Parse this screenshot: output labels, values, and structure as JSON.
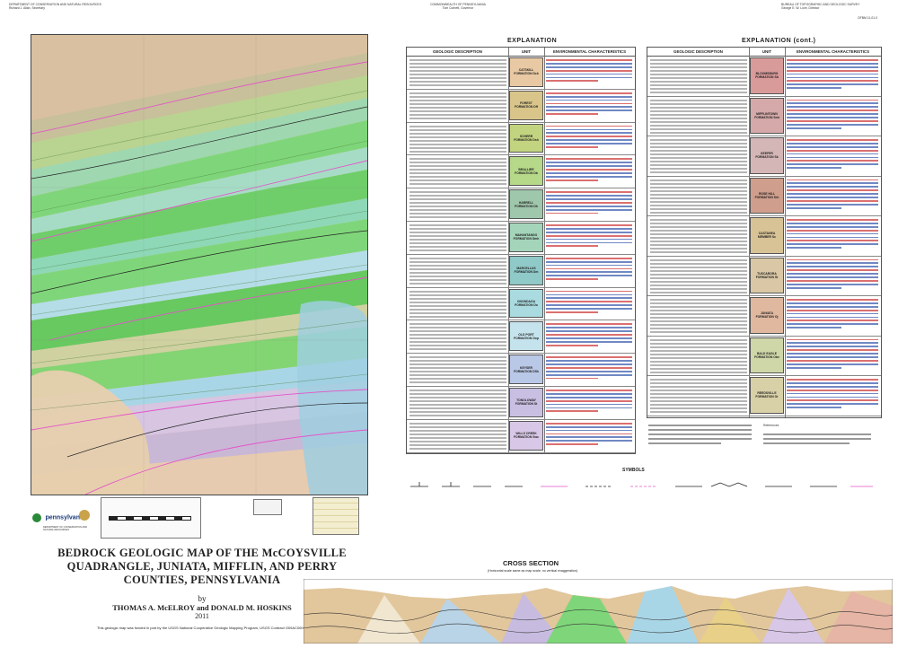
{
  "header": {
    "left": [
      "DEPARTMENT OF CONSERVATION AND NATURAL RESOURCES",
      "Richard J. Allan, Secretary"
    ],
    "center": [
      "COMMONWEALTH OF PENNSYLVANIA",
      "Tom Corbett, Governor"
    ],
    "right": [
      "BUREAU OF TOPOGRAPHIC AND GEOLOGIC SURVEY",
      "George E. W. Love, Director"
    ],
    "sheet_id": "OFBM 11-01.0"
  },
  "title": {
    "main": "BEDROCK GEOLOGIC MAP OF THE McCOYSVILLE QUADRANGLE, JUNIATA, MIFFLIN, AND PERRY COUNTIES, PENNSYLVANIA",
    "by": "by",
    "authors": "THOMAS A. McELROY and DONALD M. HOSKINS",
    "year": "2011",
    "funding": "This geologic map was funded in part by the USGS National Cooperative Geologic Mapping Program, USGS Contract G09AC00001"
  },
  "logos": {
    "pa": "pennsylvania",
    "pa_sub": "DEPARTMENT OF CONSERVATION AND NATURAL RESOURCES"
  },
  "explanation": {
    "left_title": "EXPLANATION",
    "right_title": "EXPLANATION (cont.)",
    "headers": [
      "GEOLOGIC DESCRIPTION",
      "UNIT",
      "ENVIRONMENTAL CHARACTERISTICS"
    ],
    "left_units": [
      {
        "name": "CATSKILL FORMATION Dck",
        "color": "#e9c9a3"
      },
      {
        "name": "FOREST FORMATION Dff",
        "color": "#d9c58a"
      },
      {
        "name": "SCHERR FORMATION Dsh",
        "color": "#c2d47f"
      },
      {
        "name": "BRALLIER FORMATION Db",
        "color": "#b6d889"
      },
      {
        "name": "HARRELL FORMATION Dh",
        "color": "#9fc7ab"
      },
      {
        "name": "MAHANTANGO FORMATION Dmh",
        "color": "#a4d4b9"
      },
      {
        "name": "MARCELLUS FORMATION Dm",
        "color": "#8fc9c8"
      },
      {
        "name": "ONONDAGA FORMATION Do",
        "color": "#a9dbe0"
      },
      {
        "name": "OLD PORT FORMATION Dop",
        "color": "#c5e3ec"
      },
      {
        "name": "KEYSER FORMATION DSk",
        "color": "#b9c8e6"
      },
      {
        "name": "TONOLOWAY FORMATION St",
        "color": "#c8bfe2"
      },
      {
        "name": "WILLS CREEK FORMATION Swc",
        "color": "#d8c7e6"
      }
    ],
    "right_units": [
      {
        "name": "BLOOMSBURG FORMATION Sb",
        "color": "#d99a9a"
      },
      {
        "name": "MIFFLINTOWN FORMATION Smt",
        "color": "#d5a9a9"
      },
      {
        "name": "KEEFER FORMATION Sk",
        "color": "#d4b6b6"
      },
      {
        "name": "ROSE HILL FORMATION Srh",
        "color": "#cf9e8c"
      },
      {
        "name": "CASTANEA MEMBER Sc",
        "color": "#d8c396"
      },
      {
        "name": "TUSCARORA FORMATION St",
        "color": "#d9c7a5"
      },
      {
        "name": "JUNIATA FORMATION Oj",
        "color": "#e0b8a0"
      },
      {
        "name": "BALD EAGLE FORMATION Obe",
        "color": "#cfd6a8"
      },
      {
        "name": "REEDSVILLE FORMATION Or",
        "color": "#d8d0a6"
      }
    ]
  },
  "symbols": {
    "title": "SYMBOLS"
  },
  "cross_section": {
    "title": "CROSS SECTION",
    "subtitle": "(Horizontal scale same as map scale; no vertical exaggeration)"
  },
  "references": {
    "label": "References"
  },
  "colors": {
    "map_green": "#7fd67a",
    "map_tan": "#e3c79b",
    "map_blue": "#a9d6e6",
    "contact_pink": "#e455c8"
  }
}
